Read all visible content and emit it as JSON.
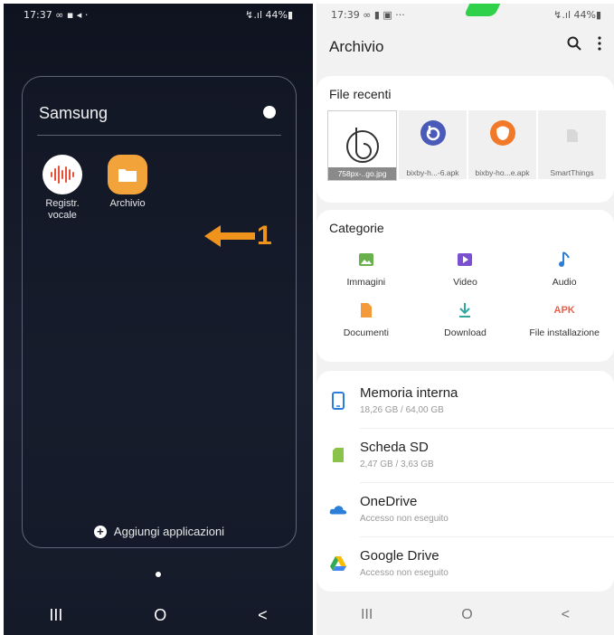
{
  "left": {
    "status": {
      "time": "17:37 ∞ ▪ ◂ ·",
      "right": "↯.ıl 44%▮"
    },
    "folder": {
      "title": "Samsung",
      "apps": [
        {
          "label": "Registr. vocale",
          "icon": "voice-recorder-icon",
          "color": "#e8503a"
        },
        {
          "label": "Archivio",
          "icon": "my-files-icon",
          "color": "#f2a33a"
        }
      ],
      "add_label": "Aggiungi applicazioni"
    },
    "annotation": "1",
    "nav": {
      "recents": "III",
      "home": "O",
      "back": "<"
    }
  },
  "right": {
    "status": {
      "time": "17:39 ∞ ▮ ▣ ···",
      "right": "↯.ıl 44%▮"
    },
    "title": "Archivio",
    "recent": {
      "heading": "File recenti",
      "files": [
        {
          "caption": "758px-..go.jpg",
          "icon": "bixby-image-icon"
        },
        {
          "caption": "bixby-h...-6.apk",
          "icon": "bixby-apk-icon"
        },
        {
          "caption": "bixby-ho...e.apk",
          "icon": "bixby-orange-icon"
        },
        {
          "caption": "SmartThings",
          "icon": "document-icon"
        }
      ]
    },
    "categories": {
      "heading": "Categorie",
      "items": [
        {
          "label": "Immagini",
          "icon": "image-icon",
          "color": "#6ab04c"
        },
        {
          "label": "Video",
          "icon": "video-icon",
          "color": "#7a4fd0"
        },
        {
          "label": "Audio",
          "icon": "audio-icon",
          "color": "#2b7fd8"
        },
        {
          "label": "Documenti",
          "icon": "document-icon",
          "color": "#f39a3c"
        },
        {
          "label": "Download",
          "icon": "download-icon",
          "color": "#2fa6a0"
        },
        {
          "label": "File installazione",
          "icon": "apk-icon",
          "color": "#e8604c",
          "icon_text": "APK"
        }
      ]
    },
    "storage": [
      {
        "name": "Memoria interna",
        "sub": "18,26 GB / 64,00 GB",
        "icon": "phone-storage-icon",
        "color": "#2b7fd8"
      },
      {
        "name": "Scheda SD",
        "sub": "2,47 GB / 3,63 GB",
        "icon": "sd-card-icon",
        "color": "#8bc34a"
      },
      {
        "name": "OneDrive",
        "sub": "Accesso non eseguito",
        "icon": "onedrive-icon",
        "color": "#2b7fd8"
      },
      {
        "name": "Google Drive",
        "sub": "Accesso non eseguito",
        "icon": "google-drive-icon",
        "color": "#34a853"
      }
    ],
    "nav": {
      "recents": "III",
      "home": "O",
      "back": "<"
    }
  }
}
